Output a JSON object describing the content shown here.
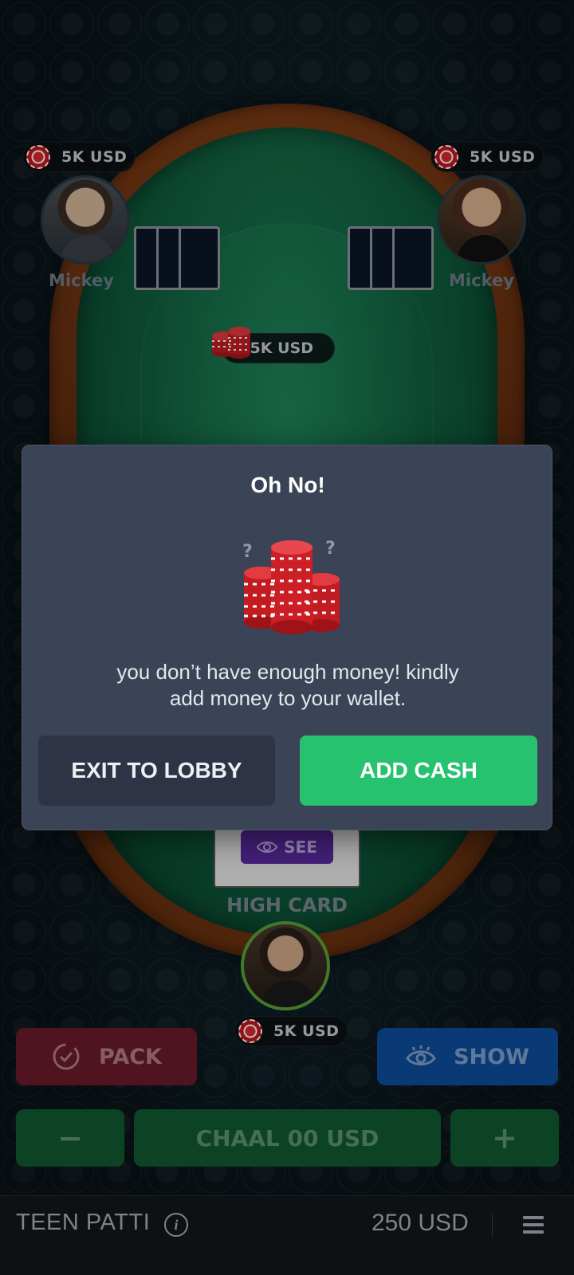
{
  "players": {
    "left": {
      "name": "Mickey",
      "balance": "5K USD"
    },
    "right": {
      "name": "Mickey",
      "balance": "5K USD"
    },
    "me": {
      "balance": "5K USD",
      "hand": "HIGH CARD",
      "see_label": "SEE"
    }
  },
  "pot": {
    "amount": "5K USD"
  },
  "actions": {
    "pack_label": "PACK",
    "show_label": "SHOW",
    "minus_label": "−",
    "chaal_label": "CHAAL 00 USD",
    "plus_label": "+"
  },
  "footer": {
    "game_title": "TEEN PATTI",
    "info_icon": "i",
    "wallet_balance": "250 USD"
  },
  "modal": {
    "title": "Oh No!",
    "message_line1": "you don’t have enough money! kindly",
    "message_line2": "add money to your wallet.",
    "exit_label": "EXIT TO LOBBY",
    "add_cash_label": "ADD CASH"
  },
  "colors": {
    "modal_bg": "#3a4456",
    "add_cash": "#27c26f",
    "exit": "#2e3445",
    "felt": "#116040",
    "rim": "#6a3210"
  },
  "icons": [
    "chip-icon",
    "chip-stack-icon",
    "eye-icon",
    "pack-icon",
    "info-icon",
    "menu-icon"
  ]
}
